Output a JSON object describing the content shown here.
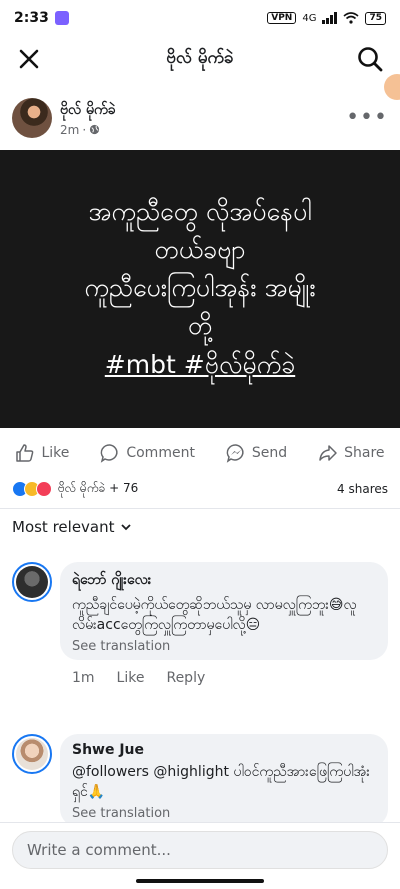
{
  "status_bar": {
    "time": "2:33",
    "vpn": "VPN",
    "network": "4G",
    "battery": "75"
  },
  "header": {
    "title": "ဗိုလ် မိုက်ခဲ"
  },
  "post": {
    "author": "ဗိုလ် မိုက်ခဲ",
    "time": "2m",
    "image_lines": [
      "အကူညီတွေ လိုအပ်နေပါ",
      "တယ်ခဗျာ",
      "ကူညီပေးကြပါအုန်း အမျိုး",
      "တို့"
    ],
    "image_tags": "#mbt #ဗိုလ်မိုက်ခဲ"
  },
  "actions": {
    "like": "Like",
    "comment": "Comment",
    "send": "Send",
    "share": "Share"
  },
  "reactions": {
    "names": "ဗိုလ် မိုက်ခဲ + 76",
    "shares": "4 shares"
  },
  "sort": {
    "label": "Most relevant"
  },
  "comments": [
    {
      "author": "ရဲဘော် ဂျိုးလေး",
      "text": "ကူညီချင်ပေမဲ့ကိုယ်တွေဆိုဘယ်သူမှ လာမလှူကြဘူး😅လူ လိမ်းaccတွေကြလှူကြတာမှပေါလို့😑",
      "translate": "See translation",
      "time": "1m",
      "like": "Like",
      "reply": "Reply"
    },
    {
      "author": "Shwe Jue",
      "text": "@followers @highlight ပါဝင်ကူညီအားဖြေကြပါအုံးရှင်🙏",
      "translate": "See translation"
    }
  ],
  "composer": {
    "placeholder": "Write a comment..."
  }
}
